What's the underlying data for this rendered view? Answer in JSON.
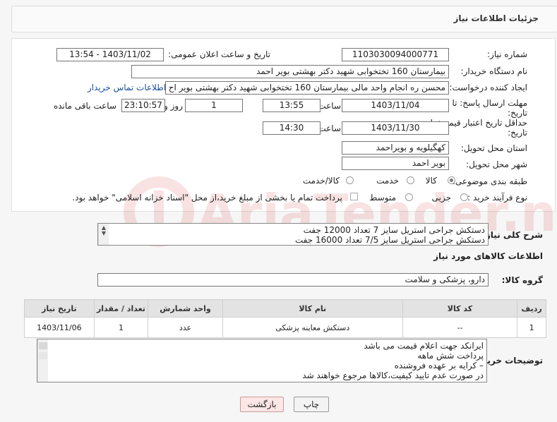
{
  "header": {
    "title": "جزئیات اطلاعات نیاز"
  },
  "fields": {
    "need_number_label": "شماره نیاز:",
    "need_number": "1103030094000771",
    "announce_label": "تاریخ و ساعت اعلان عمومی:",
    "announce_value": "1403/11/02 - 13:54",
    "buyer_org_label": "نام دستگاه خریدار:",
    "buyer_org": "بیمارستان 160 تختخوابی شهید دکتر بهشتی بویر احمد",
    "creator_label": "ایجاد کننده درخواست:",
    "creator": "محسن ره انجام واحد مالی بیمارستان 160 تختخوابی شهید دکتر بهشتی بویر اح",
    "contact_link": "اطلاعات تماس خریدار",
    "reply_deadline_label": "مهلت ارسال پاسخ: تا",
    "reply_deadline_label2": "تاریخ:",
    "reply_date": "1403/11/04",
    "time_label": "ساعت",
    "reply_time": "13:55",
    "days_value": "1",
    "days_label": "روز و",
    "remaining_time": "23:10:57",
    "remaining_label": "ساعت باقی مانده",
    "price_valid_label": "حداقل تاریخ اعتبار قیمت: تا",
    "price_valid_label2": "تاریخ:",
    "price_valid_date": "1403/11/30",
    "price_valid_time": "14:30",
    "province_label": "استان محل تحویل:",
    "province": "کهگیلویه و بویراحمد",
    "city_label": "شهر محل تحویل:",
    "city": "بویر احمد",
    "category_label": "طبقه بندی موضوعی:",
    "category_options": [
      "کالا",
      "خدمت",
      "کالا/خدمت"
    ],
    "process_label": "نوع فرآیند خرید :",
    "process_options": [
      "جزیی",
      "متوسط"
    ],
    "payment_note": "پرداخت تمام یا بخشی از مبلغ خرید،از محل \"اسناد خزانه اسلامی\" خواهد بود."
  },
  "description": {
    "label": "شرح کلی نیاز:",
    "lines": [
      "دستکش جراحی استریل سایز 7 تعداد 12000 جفت",
      "دستکش جراحی استریل سایز 7/5 تعداد 16000 جفت"
    ]
  },
  "goods_section": {
    "title": "اطلاعات کالاهای مورد نیاز"
  },
  "goods_group": {
    "label": "گروه کالا:",
    "value": "دارو، پزشکی و سلامت"
  },
  "table": {
    "headers": [
      "ردیف",
      "کد کالا",
      "نام کالا",
      "واحد شمارش",
      "تعداد / مقدار",
      "تاریخ نیاز"
    ],
    "rows": [
      [
        "1",
        "--",
        "دستکش معاینه پزشکی",
        "عدد",
        "1",
        "1403/11/06"
      ]
    ]
  },
  "buyer_notes": {
    "label": "توضیحات خریدار:",
    "lines": [
      "ایرانکد جهت اعلام قیمت می باشد",
      "پرداخت شش ماهه",
      "– کرایه بر عهده فروشنده",
      "در صورت عدم تایید کیفیت،کالاها مرجوع خواهند شد"
    ]
  },
  "buttons": {
    "print": "چاپ",
    "back": "بازگشت"
  },
  "watermark": {
    "text": "AriaTender.neT"
  }
}
